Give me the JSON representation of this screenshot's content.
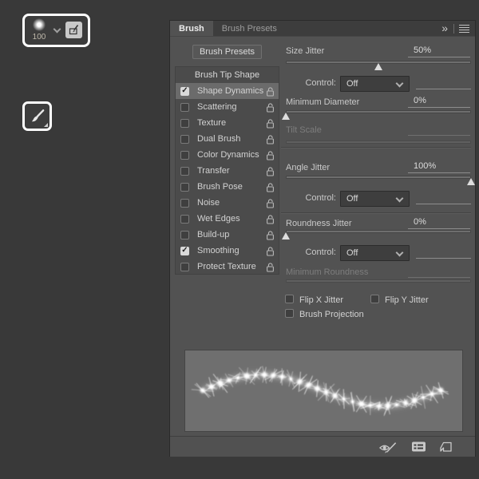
{
  "icons": {
    "check": "✓",
    "collapse": "»"
  },
  "options_bar": {
    "brush_size": "100"
  },
  "panel": {
    "tabs": [
      {
        "label": "Brush",
        "active": true
      },
      {
        "label": "Brush Presets",
        "active": false
      }
    ],
    "presets_button": "Brush Presets",
    "list": {
      "header": "Brush Tip Shape",
      "items": [
        {
          "label": "Shape Dynamics",
          "checked": true,
          "selected": true
        },
        {
          "label": "Scattering",
          "checked": false
        },
        {
          "label": "Texture",
          "checked": false
        },
        {
          "label": "Dual Brush",
          "checked": false
        },
        {
          "label": "Color Dynamics",
          "checked": false
        },
        {
          "label": "Transfer",
          "checked": false
        },
        {
          "label": "Brush Pose",
          "checked": false
        },
        {
          "label": "Noise",
          "checked": false
        },
        {
          "label": "Wet Edges",
          "checked": false
        },
        {
          "label": "Build-up",
          "checked": false
        },
        {
          "label": "Smoothing",
          "checked": true
        },
        {
          "label": "Protect Texture",
          "checked": false
        }
      ]
    },
    "settings": {
      "size_jitter": {
        "label": "Size Jitter",
        "value": "50%",
        "percent": 50
      },
      "control_size": {
        "label": "Control:",
        "value": "Off"
      },
      "minimum_diameter": {
        "label": "Minimum Diameter",
        "value": "0%",
        "percent": 0
      },
      "tilt_scale": {
        "label": "Tilt Scale",
        "disabled": true
      },
      "angle_jitter": {
        "label": "Angle Jitter",
        "value": "100%",
        "percent": 100
      },
      "control_angle": {
        "label": "Control:",
        "value": "Off"
      },
      "roundness_jitter": {
        "label": "Roundness Jitter",
        "value": "0%",
        "percent": 0
      },
      "control_roundness": {
        "label": "Control:",
        "value": "Off"
      },
      "minimum_roundness": {
        "label": "Minimum Roundness",
        "disabled": true
      },
      "flip_x": {
        "label": "Flip X Jitter",
        "checked": false
      },
      "flip_y": {
        "label": "Flip Y Jitter",
        "checked": false
      },
      "brush_projection": {
        "label": "Brush Projection",
        "checked": false
      }
    }
  }
}
